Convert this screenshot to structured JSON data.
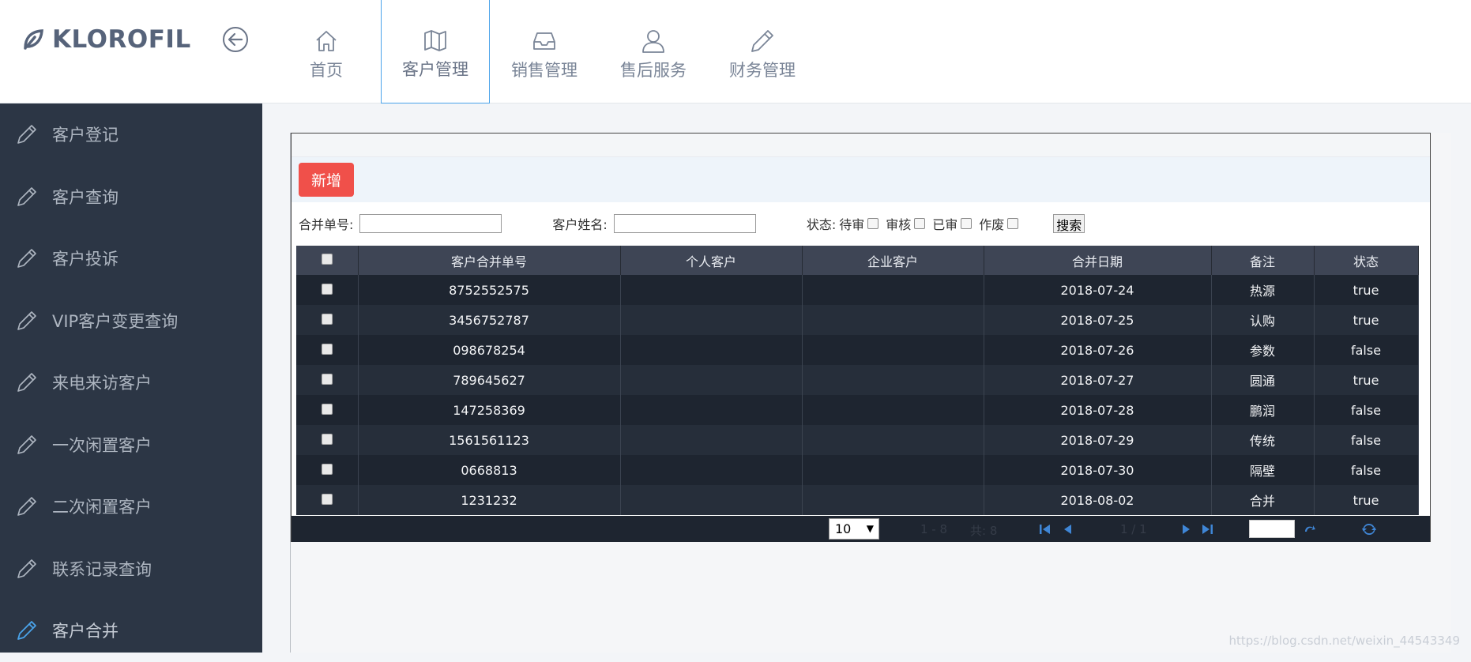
{
  "app": {
    "brand": "KLOROFIL"
  },
  "nav": {
    "items": [
      {
        "label": "首页",
        "icon": "home-icon"
      },
      {
        "label": "客户管理",
        "icon": "map-icon",
        "active": true
      },
      {
        "label": "销售管理",
        "icon": "inbox-icon"
      },
      {
        "label": "售后服务",
        "icon": "user-icon"
      },
      {
        "label": "财务管理",
        "icon": "pencil-icon"
      }
    ]
  },
  "sidebar": {
    "items": [
      {
        "label": "客户登记"
      },
      {
        "label": "客户查询"
      },
      {
        "label": "客户投诉"
      },
      {
        "label": "VIP客户变更查询"
      },
      {
        "label": "来电来访客户"
      },
      {
        "label": "一次闲置客户"
      },
      {
        "label": "二次闲置客户"
      },
      {
        "label": "联系记录查询"
      },
      {
        "label": "客户合并",
        "active": true
      }
    ]
  },
  "toolbar": {
    "add_label": "新增"
  },
  "search": {
    "merge_no_label": "合并单号:",
    "merge_no_value": "",
    "customer_name_label": "客户姓名:",
    "customer_name_value": "",
    "status_label": "状态:",
    "status_options": [
      "待审",
      "审核",
      "已审",
      "作废"
    ],
    "search_label": "搜索"
  },
  "table": {
    "columns": [
      "客户合并单号",
      "个人客户",
      "企业客户",
      "合并日期",
      "备注",
      "状态"
    ],
    "rows": [
      [
        "8752552575",
        "",
        "",
        "2018-07-24",
        "热源",
        "true"
      ],
      [
        "3456752787",
        "",
        "",
        "2018-07-25",
        "认购",
        "true"
      ],
      [
        "098678254",
        "",
        "",
        "2018-07-26",
        "参数",
        "false"
      ],
      [
        "789645627",
        "",
        "",
        "2018-07-27",
        "圆通",
        "true"
      ],
      [
        "147258369",
        "",
        "",
        "2018-07-28",
        "鹏润",
        "false"
      ],
      [
        "1561561123",
        "",
        "",
        "2018-07-29",
        "传统",
        "false"
      ],
      [
        "0668813",
        "",
        "",
        "2018-07-30",
        "隔壁",
        "false"
      ],
      [
        "1231232",
        "",
        "",
        "2018-08-02",
        "合并",
        "true"
      ]
    ]
  },
  "pager": {
    "page_size": "10",
    "range_text": "1 - 8",
    "total_text": "共: 8",
    "page_text": "1 / 1",
    "goto_value": ""
  },
  "watermark": "https://blog.csdn.net/weixin_44543349",
  "colors": {
    "accent": "#4aa3ea",
    "danger": "#f0504a",
    "sidebar": "#2c3645"
  }
}
